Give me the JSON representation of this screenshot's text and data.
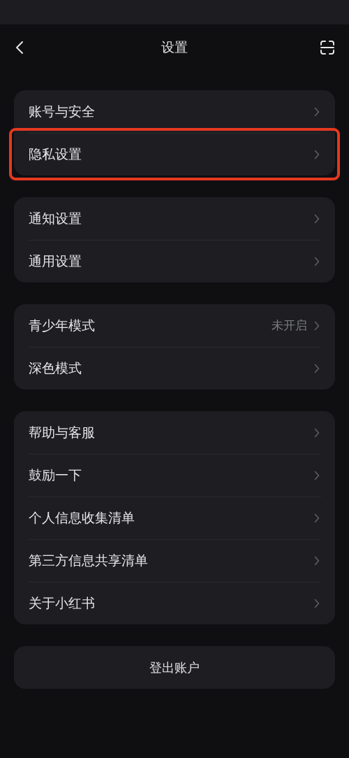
{
  "header": {
    "title": "设置"
  },
  "groups": [
    {
      "items": [
        {
          "label": "账号与安全",
          "highlighted": false
        },
        {
          "label": "隐私设置",
          "highlighted": true
        }
      ]
    },
    {
      "items": [
        {
          "label": "通知设置",
          "highlighted": false
        },
        {
          "label": "通用设置",
          "highlighted": false
        }
      ]
    },
    {
      "items": [
        {
          "label": "青少年模式",
          "value": "未开启",
          "highlighted": false
        },
        {
          "label": "深色模式",
          "highlighted": false
        }
      ]
    },
    {
      "items": [
        {
          "label": "帮助与客服",
          "highlighted": false
        },
        {
          "label": "鼓励一下",
          "highlighted": false
        },
        {
          "label": "个人信息收集清单",
          "highlighted": false
        },
        {
          "label": "第三方信息共享清单",
          "highlighted": false
        },
        {
          "label": "关于小红书",
          "highlighted": false
        }
      ]
    }
  ],
  "logout_button": "登出账户"
}
